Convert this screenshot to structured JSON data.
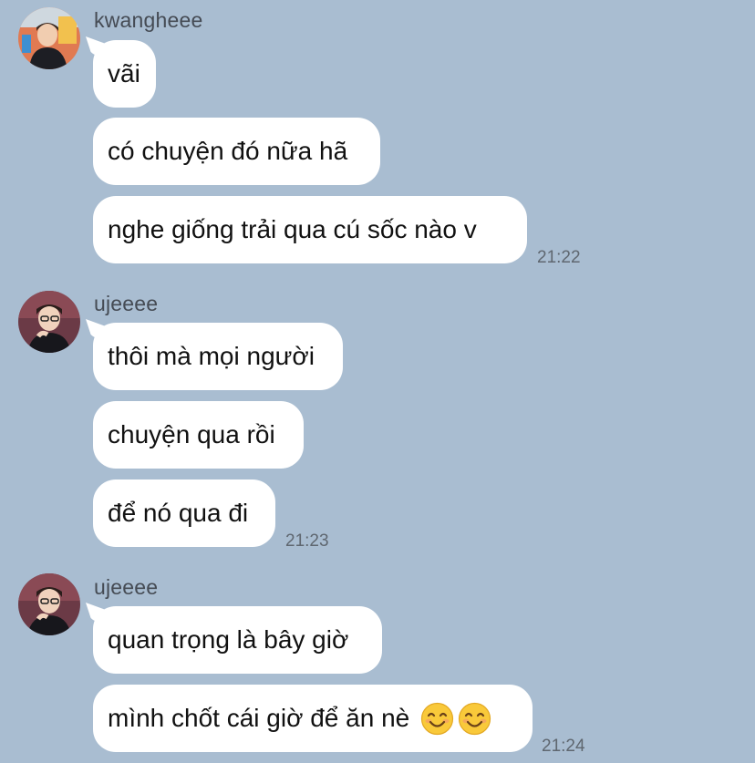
{
  "chat": {
    "groups": [
      {
        "sender": "kwangheee",
        "avatar_icon": "avatar-kwangheee",
        "messages": [
          "vãi",
          "có chuyện đó nữa hã",
          "nghe giống trải qua cú sốc nào v"
        ],
        "time": "21:22"
      },
      {
        "sender": "ujeeee",
        "avatar_icon": "avatar-ujeeee",
        "messages": [
          "thôi mà mọi người",
          "chuyện qua rồi",
          "để nó qua đi"
        ],
        "time": "21:23"
      },
      {
        "sender": "ujeeee",
        "avatar_icon": "avatar-ujeeee",
        "messages": [
          "quan trọng là bây giờ",
          "mình chốt cái giờ để ăn nè"
        ],
        "emojis": [
          "smiling-face-emoji",
          "smiling-face-emoji"
        ],
        "time": "21:24"
      }
    ]
  },
  "colors": {
    "background": "#a9bdd1",
    "bubble": "#ffffff",
    "sender_text": "#454b54",
    "time_text": "#5f6770"
  }
}
